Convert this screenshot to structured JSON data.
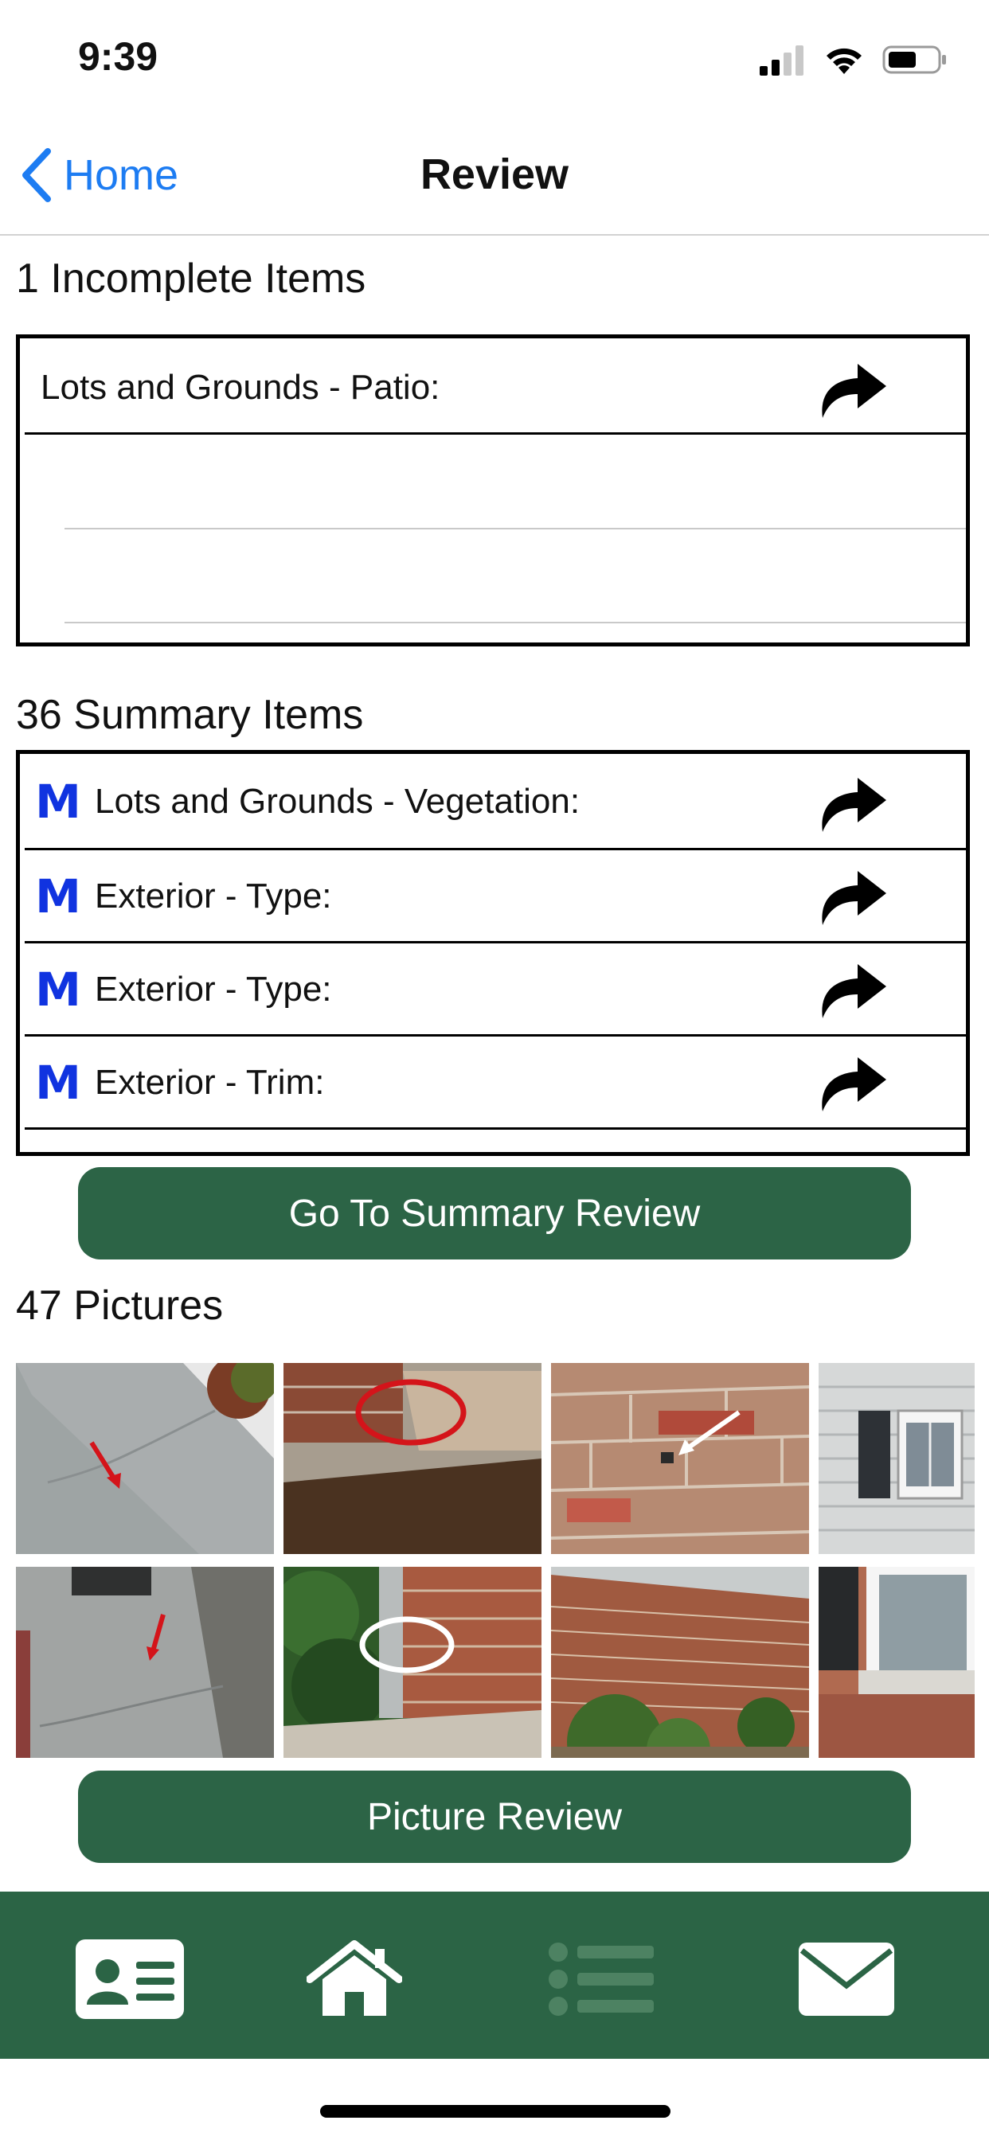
{
  "status_bar": {
    "time": "9:39"
  },
  "nav": {
    "back_label": "Home",
    "title": "Review"
  },
  "incomplete": {
    "title": "1 Incomplete Items",
    "items": [
      {
        "label": "Lots and Grounds - Patio:"
      }
    ]
  },
  "summary": {
    "title": "36 Summary Items",
    "badge": "M",
    "items": [
      {
        "badge": "M",
        "label": "Lots and Grounds - Vegetation:"
      },
      {
        "badge": "M",
        "label": "Exterior - Type:"
      },
      {
        "badge": "M",
        "label": "Exterior - Type:"
      },
      {
        "badge": "M",
        "label": "Exterior - Trim:"
      }
    ],
    "button_label": "Go To Summary Review"
  },
  "pictures": {
    "title": "47 Pictures",
    "button_label": "Picture Review"
  },
  "tabbar": {
    "items": [
      {
        "icon": "contact-card-icon"
      },
      {
        "icon": "home-icon"
      },
      {
        "icon": "list-icon"
      },
      {
        "icon": "mail-icon"
      }
    ]
  },
  "colors": {
    "accent_green": "#2c6446",
    "link_blue": "#1d7cf2",
    "badge_blue": "#1033e0"
  }
}
